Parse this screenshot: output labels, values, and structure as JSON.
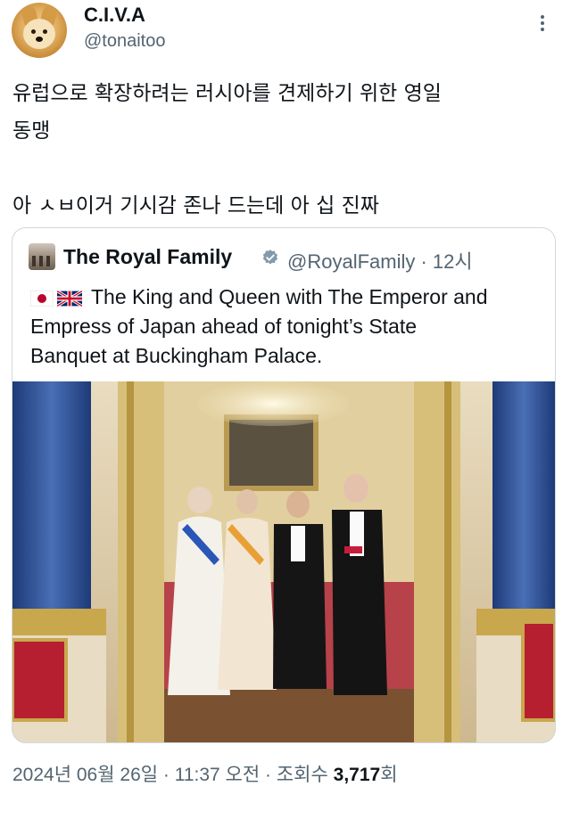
{
  "author": {
    "display_name": "C.I.V.A",
    "handle": "@tonaitoo",
    "avatar": "shiba-dog-avatar"
  },
  "menu": {
    "icon": "more-vertical-icon"
  },
  "tweet": {
    "line1": "유럽으로 확장하려는 러시아를 견제하기 위한 영일",
    "line2": "동맹",
    "line3": "아 ㅅㅂ이거 기시감 존나 드는데 아 십 진짜"
  },
  "quote": {
    "name": "The Royal Family",
    "verified_icon": "verified-badge-icon",
    "handle_time": "@RoyalFamily · 12시",
    "flags": [
      "japan-flag",
      "uk-flag"
    ],
    "text_line1": "The King and Queen with The Emperor and",
    "text_line2": "Empress of Japan ahead of tonight’s State",
    "text_line3": "Banquet at Buckingham Palace.",
    "photo": "state-banquet-palace-photo"
  },
  "meta": {
    "date_time": "2024년 06월 26일 · 11:37 오전 · 조회수 ",
    "views": "3,717",
    "views_suffix": "회"
  },
  "colors": {
    "text": "#0f1419",
    "secondary": "#536471",
    "border": "#cfd9de",
    "verified": "#829aab"
  }
}
